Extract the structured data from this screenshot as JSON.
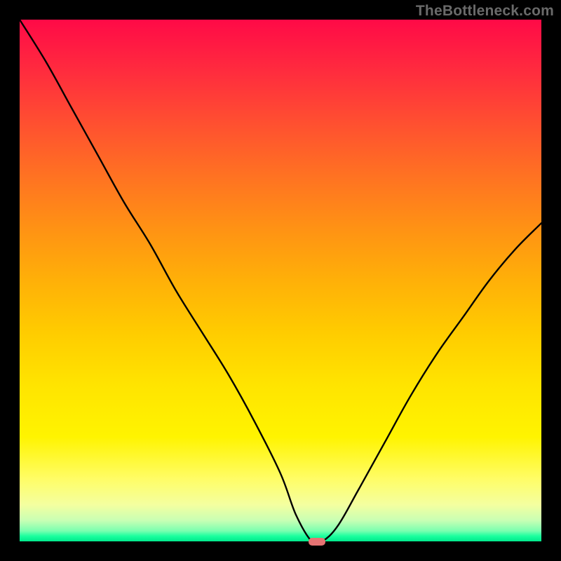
{
  "watermark": "TheBottleneck.com",
  "chart_data": {
    "type": "line",
    "title": "",
    "xlabel": "",
    "ylabel": "",
    "xlim": [
      0,
      100
    ],
    "ylim": [
      0,
      100
    ],
    "series": [
      {
        "name": "bottleneck-curve",
        "x": [
          0,
          5,
          10,
          15,
          20,
          25,
          30,
          35,
          40,
          45,
          50,
          53,
          56,
          58,
          61,
          65,
          70,
          75,
          80,
          85,
          90,
          95,
          100
        ],
        "values": [
          100,
          92,
          83,
          74,
          65,
          57,
          48,
          40,
          32,
          23,
          13,
          5,
          0,
          0,
          3,
          10,
          19,
          28,
          36,
          43,
          50,
          56,
          61
        ]
      }
    ],
    "marker": {
      "x": 57,
      "y": 0,
      "color": "#e57373"
    },
    "gradient_stops": [
      {
        "pct": 0,
        "color": "#ff0a47"
      },
      {
        "pct": 50,
        "color": "#ffcc00"
      },
      {
        "pct": 97,
        "color": "#f0ffb0"
      },
      {
        "pct": 100,
        "color": "#00e88c"
      }
    ]
  }
}
